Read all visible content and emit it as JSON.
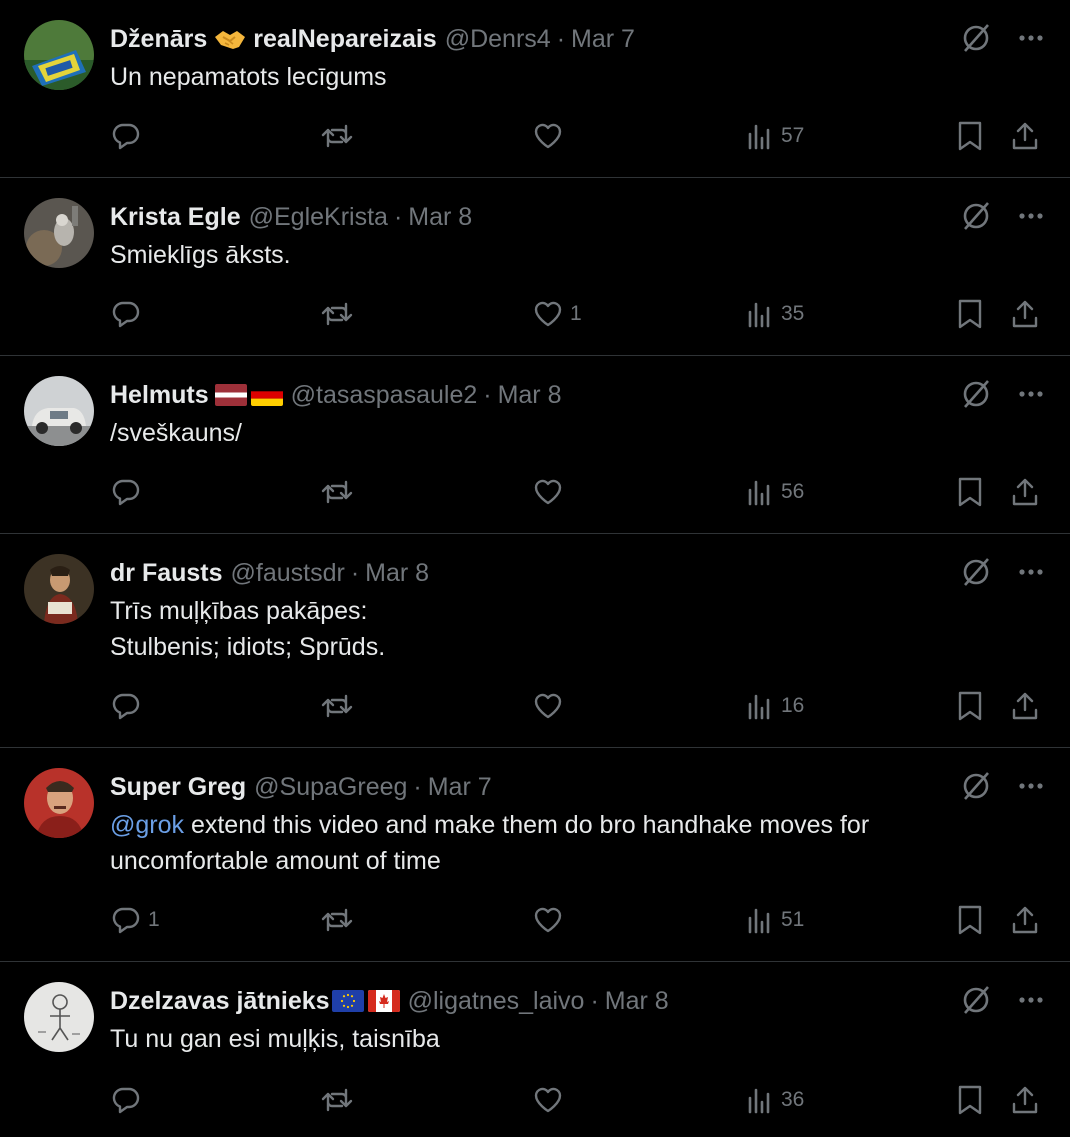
{
  "tweets": [
    {
      "name": "Dženārs",
      "name_suffix": "realNepareizais",
      "handle": "@Denrs4",
      "date": "Mar 7",
      "text_lines": [
        "Un nepamatots lecīgums"
      ],
      "mention": "",
      "replies": "",
      "retweets": "",
      "likes": "",
      "views": "57"
    },
    {
      "name": "Krista Egle",
      "name_suffix": "",
      "handle": "@EgleKrista",
      "date": "Mar 8",
      "text_lines": [
        "Smieklīgs āksts."
      ],
      "mention": "",
      "replies": "",
      "retweets": "",
      "likes": "1",
      "views": "35"
    },
    {
      "name": "Helmuts",
      "name_suffix": "",
      "handle": "@tasaspasaule2",
      "date": "Mar 8",
      "text_lines": [
        "/sveškauns/"
      ],
      "mention": "",
      "replies": "",
      "retweets": "",
      "likes": "",
      "views": "56"
    },
    {
      "name": "dr Fausts",
      "name_suffix": "",
      "handle": "@faustsdr",
      "date": "Mar 8",
      "text_lines": [
        "Trīs muļķības pakāpes:",
        "Stulbenis; idiots; Sprūds."
      ],
      "mention": "",
      "replies": "",
      "retweets": "",
      "likes": "",
      "views": "16"
    },
    {
      "name": "Super Greg",
      "name_suffix": "",
      "handle": "@SupaGreeg",
      "date": "Mar 7",
      "mention": "@grok",
      "text_lines": [
        " extend this video and make them do bro handhake moves for",
        "uncomfortable amount of time"
      ],
      "replies": "1",
      "retweets": "",
      "likes": "",
      "views": "51"
    },
    {
      "name": "Dzelzavas jātnieks",
      "name_suffix": "",
      "handle": "@ligatnes_laivo",
      "date": "Mar 8",
      "text_lines": [
        "Tu nu gan esi muļķis, taisnība"
      ],
      "mention": "",
      "replies": "",
      "retweets": "",
      "likes": "",
      "views": "36"
    }
  ],
  "separator": "·",
  "icons": {
    "reply": "reply-icon",
    "retweet": "retweet-icon",
    "like": "heart-icon",
    "views": "views-icon",
    "bookmark": "bookmark-icon",
    "share": "share-icon",
    "grok": "grok-icon",
    "more": "more-icon"
  },
  "colors": {
    "background": "#000000",
    "text": "#e7e9ea",
    "muted": "#71767b",
    "border": "#2f3336",
    "mention": "#6b9fe6"
  }
}
